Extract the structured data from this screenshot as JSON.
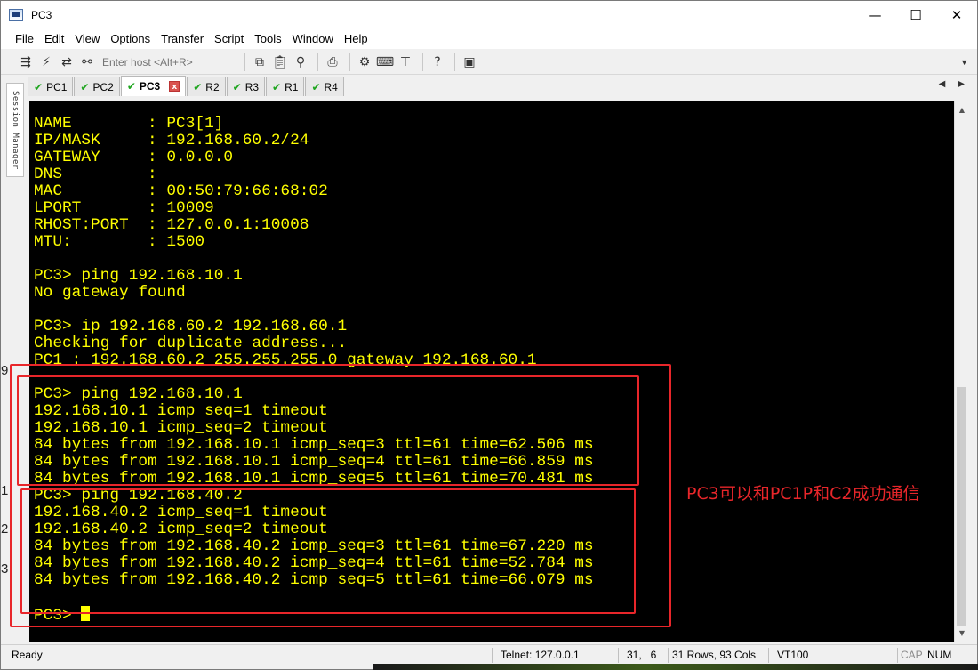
{
  "window": {
    "title": "PC3"
  },
  "controls": {
    "minimize": "—",
    "maximize": "☐",
    "close": "✕"
  },
  "menu": [
    "File",
    "Edit",
    "View",
    "Options",
    "Transfer",
    "Script",
    "Tools",
    "Window",
    "Help"
  ],
  "toolbar": {
    "host_placeholder": "Enter host <Alt+R>"
  },
  "tabs": [
    {
      "label": "PC1",
      "active": false
    },
    {
      "label": "PC2",
      "active": false
    },
    {
      "label": "PC3",
      "active": true
    },
    {
      "label": "R2",
      "active": false
    },
    {
      "label": "R3",
      "active": false
    },
    {
      "label": "R1",
      "active": false
    },
    {
      "label": "R4",
      "active": false
    }
  ],
  "tab_close_glyph": "x",
  "sidebar": {
    "label": "Session Manager"
  },
  "edge_digits": [
    "9",
    "1",
    "2",
    "3"
  ],
  "terminal": {
    "lines": [
      "NAME        : PC3[1]",
      "IP/MASK     : 192.168.60.2/24",
      "GATEWAY     : 0.0.0.0",
      "DNS         :",
      "MAC         : 00:50:79:66:68:02",
      "LPORT       : 10009",
      "RHOST:PORT  : 127.0.0.1:10008",
      "MTU:        : 1500",
      "",
      "PC3> ping 192.168.10.1",
      "No gateway found",
      "",
      "PC3> ip 192.168.60.2 192.168.60.1",
      "Checking for duplicate address...",
      "PC1 : 192.168.60.2 255.255.255.0 gateway 192.168.60.1",
      "",
      "PC3> ping 192.168.10.1",
      "192.168.10.1 icmp_seq=1 timeout",
      "192.168.10.1 icmp_seq=2 timeout",
      "84 bytes from 192.168.10.1 icmp_seq=3 ttl=61 time=62.506 ms",
      "84 bytes from 192.168.10.1 icmp_seq=4 ttl=61 time=66.859 ms",
      "84 bytes from 192.168.10.1 icmp_seq=5 ttl=61 time=70.481 ms",
      "PC3> ping 192.168.40.2",
      "192.168.40.2 icmp_seq=1 timeout",
      "192.168.40.2 icmp_seq=2 timeout",
      "84 bytes from 192.168.40.2 icmp_seq=3 ttl=61 time=67.220 ms",
      "84 bytes from 192.168.40.2 icmp_seq=4 ttl=61 time=52.784 ms",
      "84 bytes from 192.168.40.2 icmp_seq=5 ttl=61 time=66.079 ms",
      "",
      "PC3> "
    ],
    "text_color": "#ffff00",
    "background": "#000000"
  },
  "annotation": {
    "text": "PC3可以和PC1P和C2成功通信",
    "color": "#e8262a"
  },
  "status": {
    "ready": "Ready",
    "connection": "Telnet: 127.0.0.1",
    "cursor_pos": "31,   6",
    "size": "31 Rows, 93 Cols",
    "emulation": "VT100",
    "caps": "CAP",
    "num": "NUM"
  },
  "icons": {
    "toolbar": [
      "connect-icon",
      "quick-connect-icon",
      "reconnect-icon",
      "disconnect-icon",
      "copy-icon",
      "paste-icon",
      "find-icon",
      "print-icon",
      "settings-icon",
      "keymap-icon",
      "sftp-icon",
      "help-icon",
      "session-icon"
    ]
  }
}
